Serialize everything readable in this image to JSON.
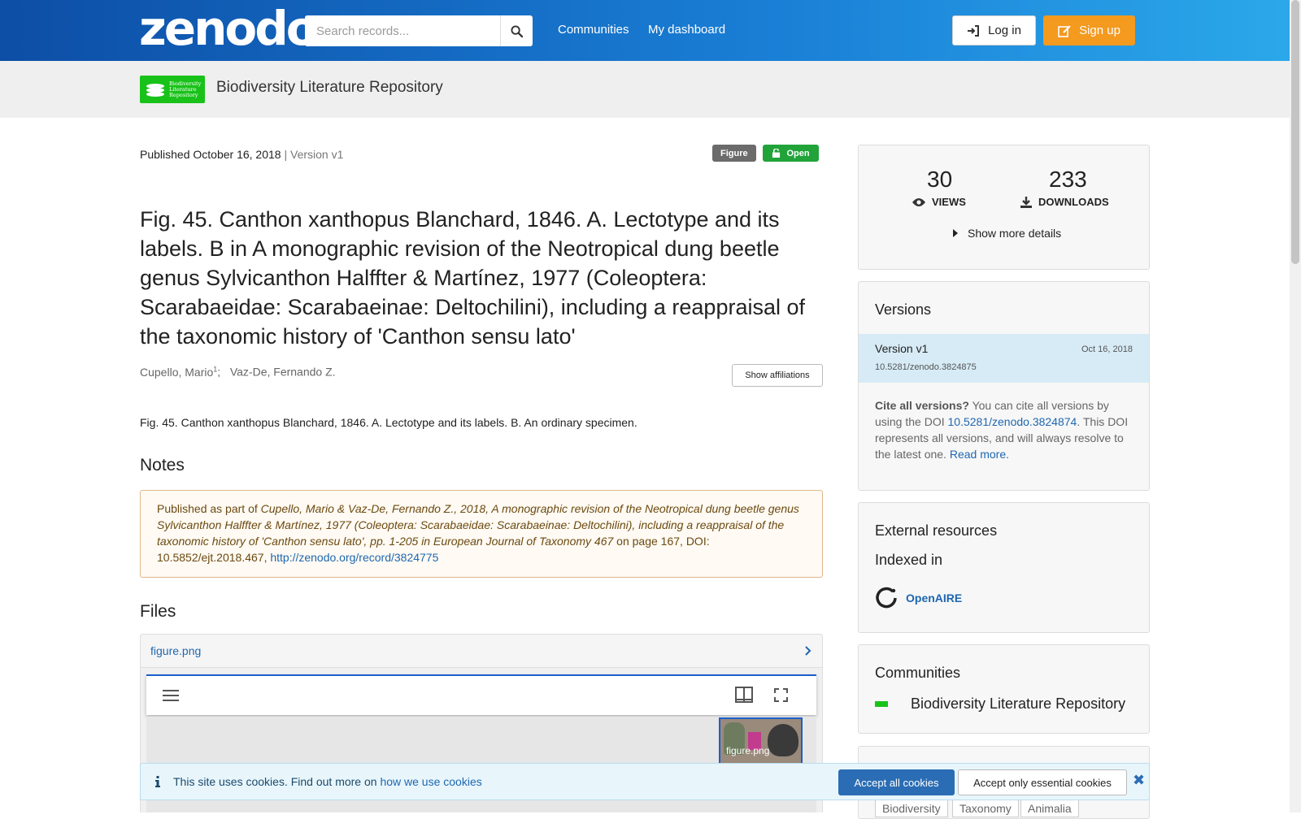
{
  "header": {
    "logo": "zenodo",
    "search_placeholder": "Search records...",
    "nav": [
      "Communities",
      "My dashboard"
    ],
    "login": "Log in",
    "signup": "Sign up"
  },
  "community_bar": {
    "logo_text": [
      "Biodiversity",
      "Literature",
      "Repository"
    ],
    "title": "Biodiversity Literature Repository"
  },
  "record": {
    "published": "Published October 16, 2018",
    "version": "Version v1",
    "badges": {
      "type": "Figure",
      "access": "Open"
    },
    "title": "Fig. 45. Canthon xanthopus Blanchard, 1846. A. Lectotype and its labels. B in A monographic revision of the Neotropical dung beetle genus Sylvicanthon Halffter & Martínez, 1977 (Coleoptera: Scarabaeidae: Scarabaeinae: Deltochilini), including a reappraisal of the taxonomic history of 'Canthon sensu lato'",
    "authors": [
      {
        "name": "Cupello, Mario",
        "sup": "1"
      },
      {
        "name": "Vaz-De, Fernando Z."
      }
    ],
    "show_affiliations": "Show affiliations",
    "description": "Fig. 45. Canthon xanthopus Blanchard, 1846. A. Lectotype and its labels. B. An ordinary specimen.",
    "notes_heading": "Notes",
    "notes": {
      "prefix": "Published as part of ",
      "citation": "Cupello, Mario & Vaz-De, Fernando Z., 2018, A monographic revision of the Neotropical dung beetle genus Sylvicanthon Halffter & Martínez, 1977 (Coleoptera: Scarabaeidae: Scarabaeinae: Deltochilini), including a reappraisal of the taxonomic history of 'Canthon sensu lato', pp. 1-205 in European Journal of Taxonomy 467",
      "suffix": " on page 167, DOI: 10.5852/ejt.2018.467, ",
      "link": "http://zenodo.org/record/3824775"
    },
    "files_heading": "Files",
    "file_name": "figure.png",
    "thumb_caption": "figure.png"
  },
  "stats": {
    "views": "30",
    "views_label": "VIEWS",
    "downloads": "233",
    "downloads_label": "DOWNLOADS",
    "show_more": "Show more details"
  },
  "versions": {
    "heading": "Versions",
    "item": {
      "label": "Version v1",
      "date": "Oct 16, 2018",
      "doi": "10.5281/zenodo.3824875"
    },
    "cite_bold": "Cite all versions?",
    "cite_text1": " You can cite all versions by using the DOI ",
    "cite_doi": "10.5281/zenodo.3824874",
    "cite_text2": ". This DOI represents all versions, and will always resolve to the latest one. ",
    "read_more": "Read more."
  },
  "external": {
    "heading": "External resources",
    "indexed": "Indexed in",
    "openaire": "OpenAIRE"
  },
  "communities": {
    "heading": "Communities",
    "item": "Biodiversity Literature Repository"
  },
  "keywords": [
    "Biodiversity",
    "Taxonomy",
    "Animalia"
  ],
  "cookie": {
    "message": "This site uses cookies. Find out more on ",
    "link": "how we use cookies",
    "accept_all": "Accept all cookies",
    "accept_essential": "Accept only essential cookies"
  },
  "colors": {
    "header_start": "#0d4ea6",
    "header_end": "#2ba8ea",
    "signup": "#f39a1f",
    "open_badge": "#21a33a",
    "link": "#1e67b0"
  }
}
